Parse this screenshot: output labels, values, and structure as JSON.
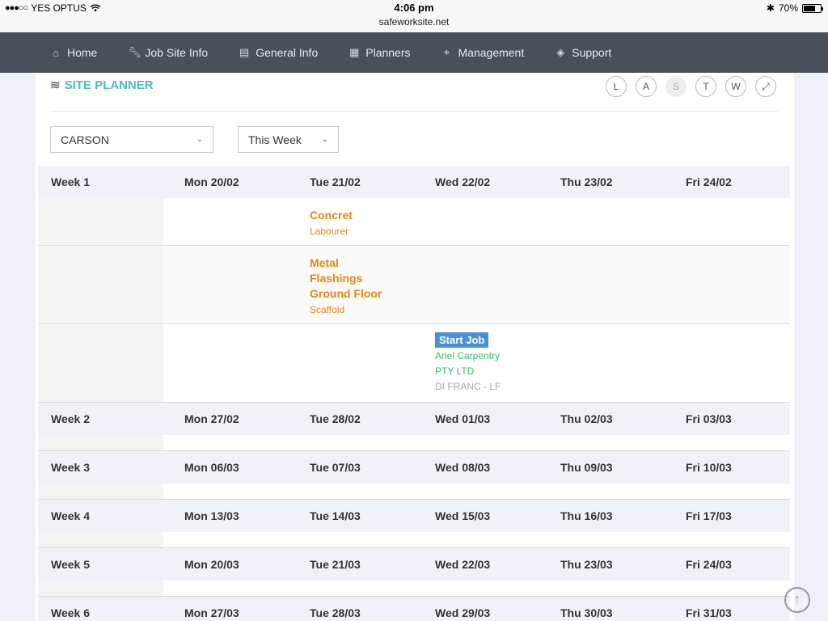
{
  "status_bar": {
    "carrier": "YES OPTUS",
    "time": "4:06 pm",
    "url": "safeworksite.net",
    "battery": "70%",
    "battery_level": 0.7
  },
  "nav": {
    "items": [
      {
        "label": "Home",
        "icon": "home-icon"
      },
      {
        "label": "Job Site Info",
        "icon": "wrench-icon"
      },
      {
        "label": "General Info",
        "icon": "document-icon"
      },
      {
        "label": "Planners",
        "icon": "calendar-icon"
      },
      {
        "label": "Management",
        "icon": "crosshair-icon"
      },
      {
        "label": "Support",
        "icon": "tag-icon"
      }
    ]
  },
  "planner": {
    "title": "SITE PLANNER",
    "view_buttons": [
      {
        "label": "L",
        "active": false
      },
      {
        "label": "A",
        "active": false
      },
      {
        "label": "S",
        "active": true
      },
      {
        "label": "T",
        "active": false
      },
      {
        "label": "W",
        "active": false
      }
    ],
    "site_select": "CARSON",
    "range_select": "This Week"
  },
  "weeks": [
    {
      "label": "Week 1",
      "days": [
        "Mon 20/02",
        "Tue 21/02",
        "Wed 22/02",
        "Thu 23/02",
        "Fri 24/02"
      ]
    },
    {
      "label": "Week 2",
      "days": [
        "Mon 27/02",
        "Tue 28/02",
        "Wed 01/03",
        "Thu 02/03",
        "Fri 03/03"
      ]
    },
    {
      "label": "Week 3",
      "days": [
        "Mon 06/03",
        "Tue 07/03",
        "Wed 08/03",
        "Thu 09/03",
        "Fri 10/03"
      ]
    },
    {
      "label": "Week 4",
      "days": [
        "Mon 13/03",
        "Tue 14/03",
        "Wed 15/03",
        "Thu 16/03",
        "Fri 17/03"
      ]
    },
    {
      "label": "Week 5",
      "days": [
        "Mon 20/03",
        "Tue 21/03",
        "Wed 22/03",
        "Thu 23/03",
        "Fri 24/03"
      ]
    },
    {
      "label": "Week 6",
      "days": [
        "Mon 27/03",
        "Tue 28/03",
        "Wed 29/03",
        "Thu 30/03",
        "Fri 31/03"
      ]
    }
  ],
  "week1_entries": [
    {
      "title": "Concret",
      "sub": "Labourer"
    },
    {
      "title_lines": [
        "Metal",
        "Flashings",
        "Ground Floor"
      ],
      "sub": "Scaffold"
    },
    {
      "badge": "Start Job",
      "company_lines": [
        "Ariel Carpentry",
        "PTY LTD"
      ],
      "contact": "DI FRANC - LF"
    }
  ]
}
